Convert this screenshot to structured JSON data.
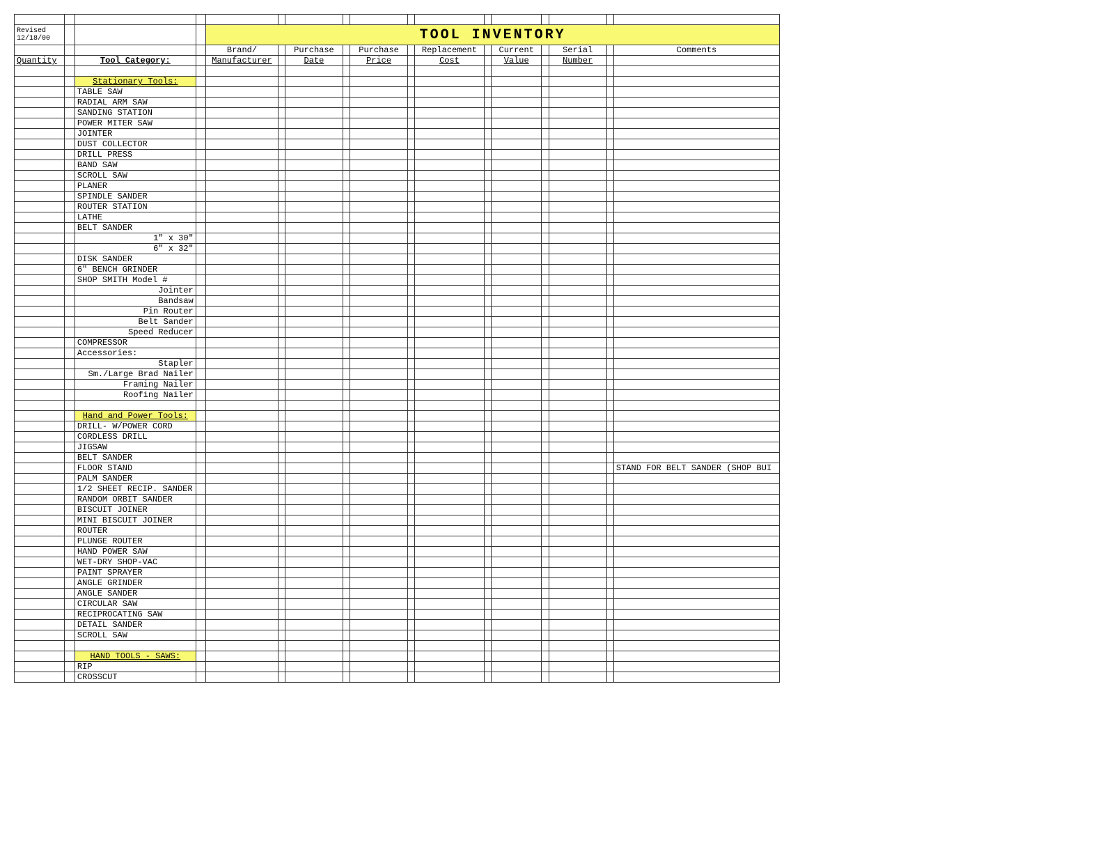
{
  "meta": {
    "revised_label": "Revised",
    "revised_date": "12/18/00"
  },
  "title": "TOOL   INVENTORY",
  "headers": {
    "row1": {
      "brand": "Brand/",
      "pdate": "Purchase",
      "price": "Purchase",
      "replacement": "Replacement",
      "current": "Current",
      "serial": "Serial",
      "comments": "Comments"
    },
    "row2": {
      "quantity": "Quantity",
      "category": "Tool Category:",
      "brand": "Manufacturer",
      "pdate": "Date",
      "price": "Price",
      "replacement": "Cost",
      "current": "Value",
      "serial": "Number"
    }
  },
  "sections": [
    {
      "heading": "Stationary Tools:",
      "rows": [
        {
          "cat": "TABLE SAW",
          "align": "left"
        },
        {
          "cat": "RADIAL ARM SAW",
          "align": "left"
        },
        {
          "cat": "SANDING STATION",
          "align": "left"
        },
        {
          "cat": "POWER MITER SAW",
          "align": "left"
        },
        {
          "cat": "JOINTER",
          "align": "left"
        },
        {
          "cat": "DUST COLLECTOR",
          "align": "left"
        },
        {
          "cat": "DRILL PRESS",
          "align": "left"
        },
        {
          "cat": "BAND SAW",
          "align": "left"
        },
        {
          "cat": "SCROLL SAW",
          "align": "left"
        },
        {
          "cat": "PLANER",
          "align": "left"
        },
        {
          "cat": "SPINDLE SANDER",
          "align": "left"
        },
        {
          "cat": "ROUTER STATION",
          "align": "left"
        },
        {
          "cat": "LATHE",
          "align": "left"
        },
        {
          "cat": "BELT SANDER",
          "align": "left"
        },
        {
          "cat": "1\" x 30\"",
          "align": "right"
        },
        {
          "cat": "6\" x 32\"",
          "align": "right"
        },
        {
          "cat": "DISK SANDER",
          "align": "left"
        },
        {
          "cat": "6\" BENCH GRINDER",
          "align": "left"
        },
        {
          "cat": "SHOP SMITH Model #",
          "align": "left"
        },
        {
          "cat": "Jointer",
          "align": "right"
        },
        {
          "cat": "Bandsaw",
          "align": "right"
        },
        {
          "cat": "Pin Router",
          "align": "right"
        },
        {
          "cat": "Belt Sander",
          "align": "right"
        },
        {
          "cat": "Speed Reducer",
          "align": "right"
        },
        {
          "cat": "COMPRESSOR",
          "align": "left"
        },
        {
          "cat": "Accessories:",
          "align": "left"
        },
        {
          "cat": "Stapler",
          "align": "right"
        },
        {
          "cat": "Sm./Large Brad Nailer",
          "align": "right"
        },
        {
          "cat": "Framing Nailer",
          "align": "right"
        },
        {
          "cat": "Roofing Nailer",
          "align": "right"
        }
      ]
    },
    {
      "heading": "Hand and Power Tools:",
      "rows": [
        {
          "cat": "DRILL- W/POWER CORD",
          "align": "left"
        },
        {
          "cat": "CORDLESS DRILL",
          "align": "left"
        },
        {
          "cat": "JIGSAW",
          "align": "left"
        },
        {
          "cat": "BELT SANDER",
          "align": "left"
        },
        {
          "cat": "FLOOR STAND",
          "align": "left",
          "comments": "STAND FOR BELT SANDER (SHOP BUI"
        },
        {
          "cat": "PALM SANDER",
          "align": "left"
        },
        {
          "cat": "1/2 SHEET RECIP. SANDER",
          "align": "left"
        },
        {
          "cat": "RANDOM ORBIT SANDER",
          "align": "left"
        },
        {
          "cat": "BISCUIT JOINER",
          "align": "left"
        },
        {
          "cat": "MINI BISCUIT JOINER",
          "align": "left"
        },
        {
          "cat": "ROUTER",
          "align": "left"
        },
        {
          "cat": "PLUNGE ROUTER",
          "align": "left"
        },
        {
          "cat": "HAND POWER SAW",
          "align": "left"
        },
        {
          "cat": "WET-DRY SHOP-VAC",
          "align": "left"
        },
        {
          "cat": "PAINT SPRAYER",
          "align": "left"
        },
        {
          "cat": "ANGLE GRINDER",
          "align": "left"
        },
        {
          "cat": "ANGLE SANDER",
          "align": "left"
        },
        {
          "cat": "CIRCULAR SAW",
          "align": "left"
        },
        {
          "cat": "RECIPROCATING SAW",
          "align": "left"
        },
        {
          "cat": "DETAIL SANDER",
          "align": "left"
        },
        {
          "cat": "SCROLL SAW",
          "align": "left"
        }
      ]
    },
    {
      "heading": "HAND TOOLS - SAWS:",
      "rows": [
        {
          "cat": "RIP",
          "align": "left"
        },
        {
          "cat": "CROSSCUT",
          "align": "left"
        }
      ]
    }
  ]
}
